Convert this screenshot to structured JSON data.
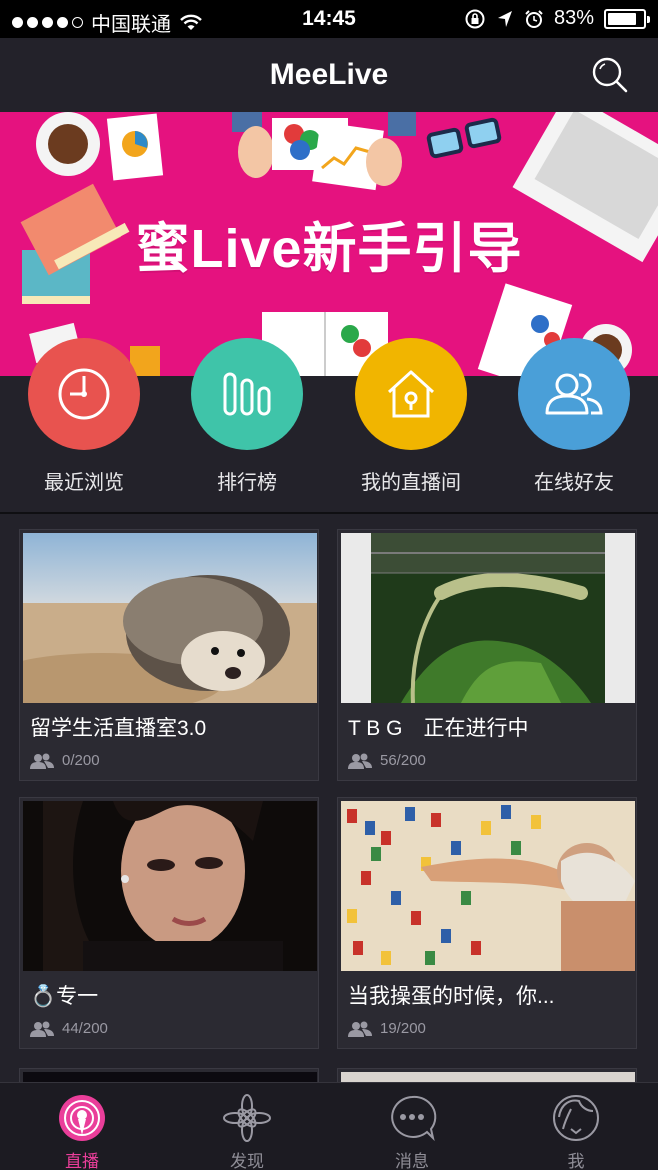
{
  "status_bar": {
    "carrier": "中国联通",
    "time": "14:45",
    "battery": "83%",
    "battery_level": 0.83
  },
  "nav": {
    "title": "MeeLive",
    "search_icon": "search-icon"
  },
  "banner": {
    "text": "蜜Live新手引导",
    "color": "#e5127f"
  },
  "quick_menu": [
    {
      "label": "最近浏览",
      "icon": "clock-icon",
      "color": "#e8534f"
    },
    {
      "label": "排行榜",
      "icon": "bar-chart-icon",
      "color": "#3fc4a9"
    },
    {
      "label": "我的直播间",
      "icon": "house-icon",
      "color": "#f1b500"
    },
    {
      "label": "在线好友",
      "icon": "friends-icon",
      "color": "#4a9fd8"
    }
  ],
  "cards": [
    {
      "title": "留学生活直播室3.0",
      "viewers": "0/200",
      "thumb": "hedgehog"
    },
    {
      "title": "T B G　正在进行中",
      "viewers": "56/200",
      "thumb": "lizard"
    },
    {
      "title": "💍专一",
      "viewers": "44/200",
      "thumb": "portrait"
    },
    {
      "title": "当我操蛋的时候，你...",
      "viewers": "19/200",
      "thumb": "crowd-painting"
    }
  ],
  "tabs": [
    {
      "label": "直播",
      "icon": "live-broadcast-icon",
      "active": true
    },
    {
      "label": "发现",
      "icon": "flower-icon",
      "active": false
    },
    {
      "label": "消息",
      "icon": "chat-bubble-icon",
      "active": false
    },
    {
      "label": "我",
      "icon": "profile-face-icon",
      "active": false
    }
  ],
  "colors": {
    "background": "#23222a",
    "accent": "#ea3e9a"
  }
}
